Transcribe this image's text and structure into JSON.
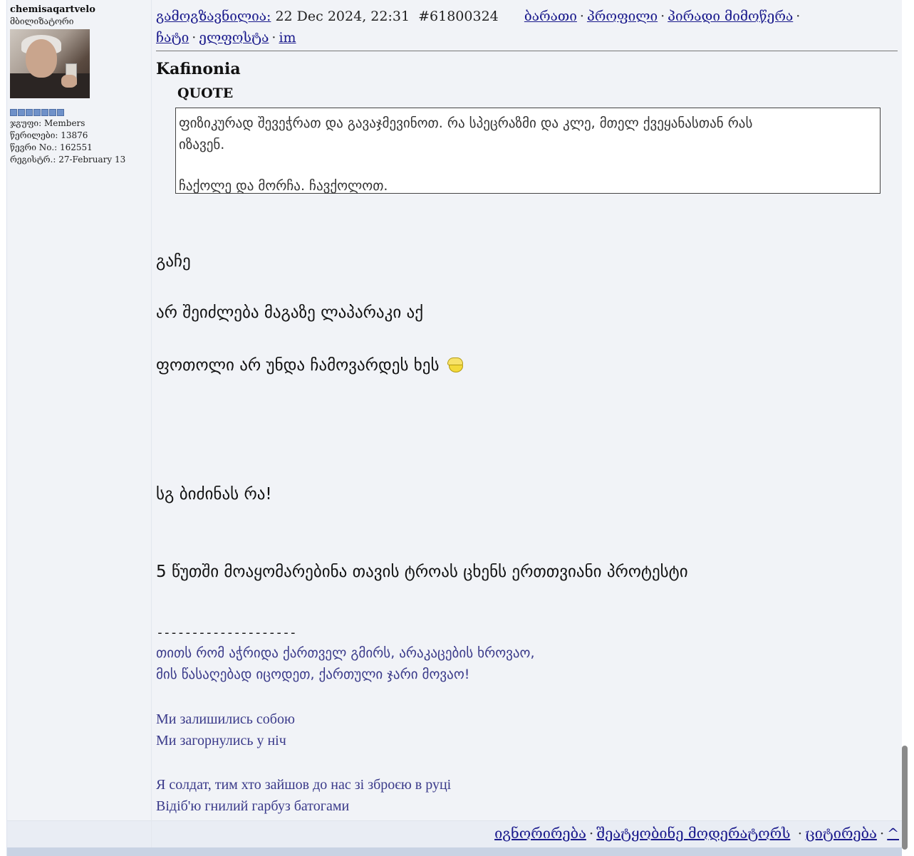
{
  "post": {
    "user": {
      "username": "chemisaqartvelo",
      "title": "მბილიზატორი",
      "pips_count": 7,
      "group": "ჯგუფი: Members",
      "posts": "წერილები: 13876",
      "member_no": "წევრი No.: 162551",
      "registered": "რეგისტრ.: 27-February 13"
    },
    "header": {
      "sent_label": "გამოგზავნილია:",
      "datetime": "22 Dec 2024, 22:31",
      "post_id": "#61800324",
      "links": [
        "ბარათი",
        "პროფილი",
        "პირადი მიმოწერა",
        "ჩატი",
        "ელფოსტა",
        "im"
      ]
    },
    "quote": {
      "author": "Kafinonia",
      "label": "QUOTE",
      "line1": "ფიზიკურად შევეჭრათ და გავაჯმევინოთ. რა სპეცრაზმი და კლე, მთელ ქვეყანასთან რას",
      "line2": "იზავენ.",
      "line3": "ჩაქოლე და მორჩა. ჩავქოლოთ."
    },
    "body": {
      "line1": "გაჩე",
      "line2": "არ შეიძლება მაგაზე ლაპარაკი აქ",
      "line3": "ფოთოლი არ უნდა ჩამოვარდეს ხეს",
      "line4": "სგ ბიძინას რა!",
      "line5": "5 წუთში მოაყომარებინა თავის ტროას ცხენს ერთთვიანი პროტესტი"
    },
    "signature": {
      "divider": "--------------------",
      "geo1": "თითს რომ აჭრიდა ქართველ გმირს, არაკაცების ხროვაო,",
      "geo2": "მის წასაღებად იცოდეთ, ქართული ჯარი მოვაო!",
      "ukr1": "Ми залишились собою",
      "ukr2": "Ми загорнулись у ніч",
      "ukr3": "Я солдат, тим хто зайшов до нас зі зброєю в руці",
      "ukr4": "Відіб'ю гнилий гарбуз батогами"
    },
    "footer": {
      "ignore": "იგნორირება",
      "report": "შეატყობინე მოდერატორს",
      "quote": "ციტირება",
      "top": "^"
    }
  },
  "colors": {
    "link": "#1a1a8c",
    "signature": "#3a3a8a",
    "panel_bg": "#f1f3f7",
    "pip": "#6f91c9"
  }
}
